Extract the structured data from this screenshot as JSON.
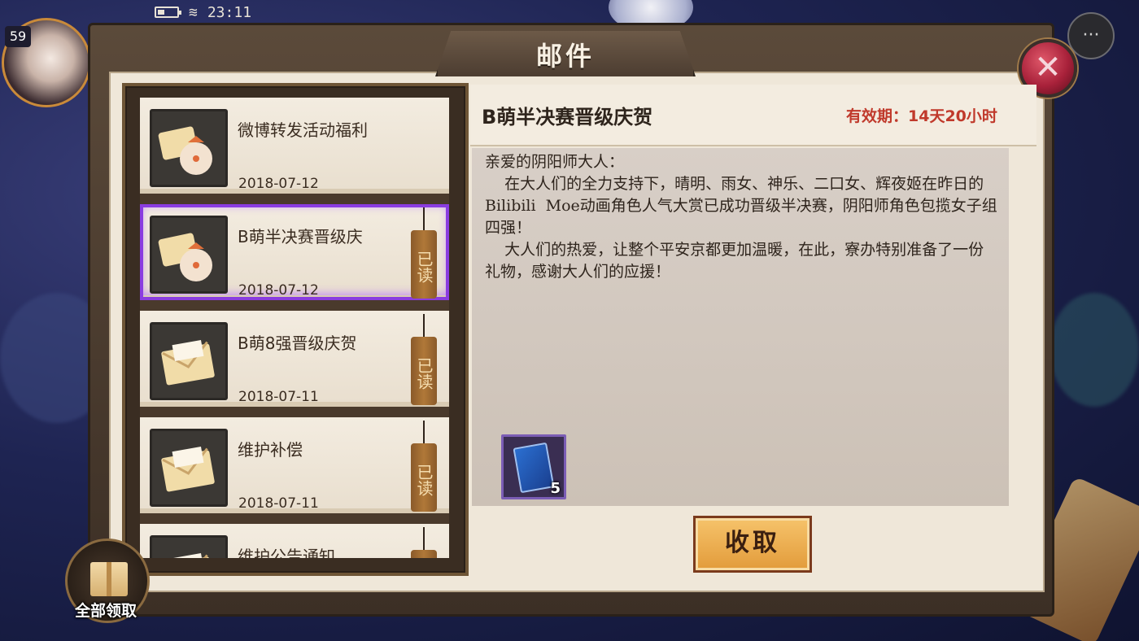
{
  "status_bar": {
    "time": "23:11"
  },
  "player": {
    "level": "59"
  },
  "window": {
    "title": "邮件",
    "close_glyph": "✕"
  },
  "chat": {
    "glyph": "···"
  },
  "mail_list": [
    {
      "title": "微博转发活动福利",
      "date": "2018-07-12",
      "read": false,
      "selected": false,
      "icon": "gift-bundle-icon"
    },
    {
      "title": "B萌半决赛晋级庆",
      "date": "2018-07-12",
      "read": true,
      "selected": true,
      "icon": "gift-bundle-icon"
    },
    {
      "title": "B萌8强晋级庆贺",
      "date": "2018-07-11",
      "read": true,
      "selected": false,
      "icon": "envelope-icon"
    },
    {
      "title": "维护补偿",
      "date": "2018-07-11",
      "read": true,
      "selected": false,
      "icon": "envelope-icon"
    },
    {
      "title": "维护公告通知",
      "date": "",
      "read": true,
      "selected": false,
      "icon": "envelope-icon"
    }
  ],
  "read_label": "已读",
  "mail_detail": {
    "subject": "B萌半决赛晋级庆贺",
    "validity": "有效期：14天20小时",
    "body": "亲爱的阴阳师大人：\n    在大人们的全力支持下，晴明、雨女、神乐、二口女、辉夜姬在昨日的Bilibili  Moe动画角色人气大赏已成功晋级半决赛，阴阳师角色包揽女子组四强！\n    大人们的热爱，让整个平安京都更加温暖，在此，寮办特别准备了一份礼物，感谢大人们的应援！",
    "reward": {
      "icon": "ticket-icon",
      "count": "5"
    },
    "collect_label": "收取"
  },
  "claim_all_label": "全部领取",
  "colors": {
    "validity": "#c0392b",
    "selected_border": "#8a3ce0",
    "collect_button": "#f6c36b"
  }
}
